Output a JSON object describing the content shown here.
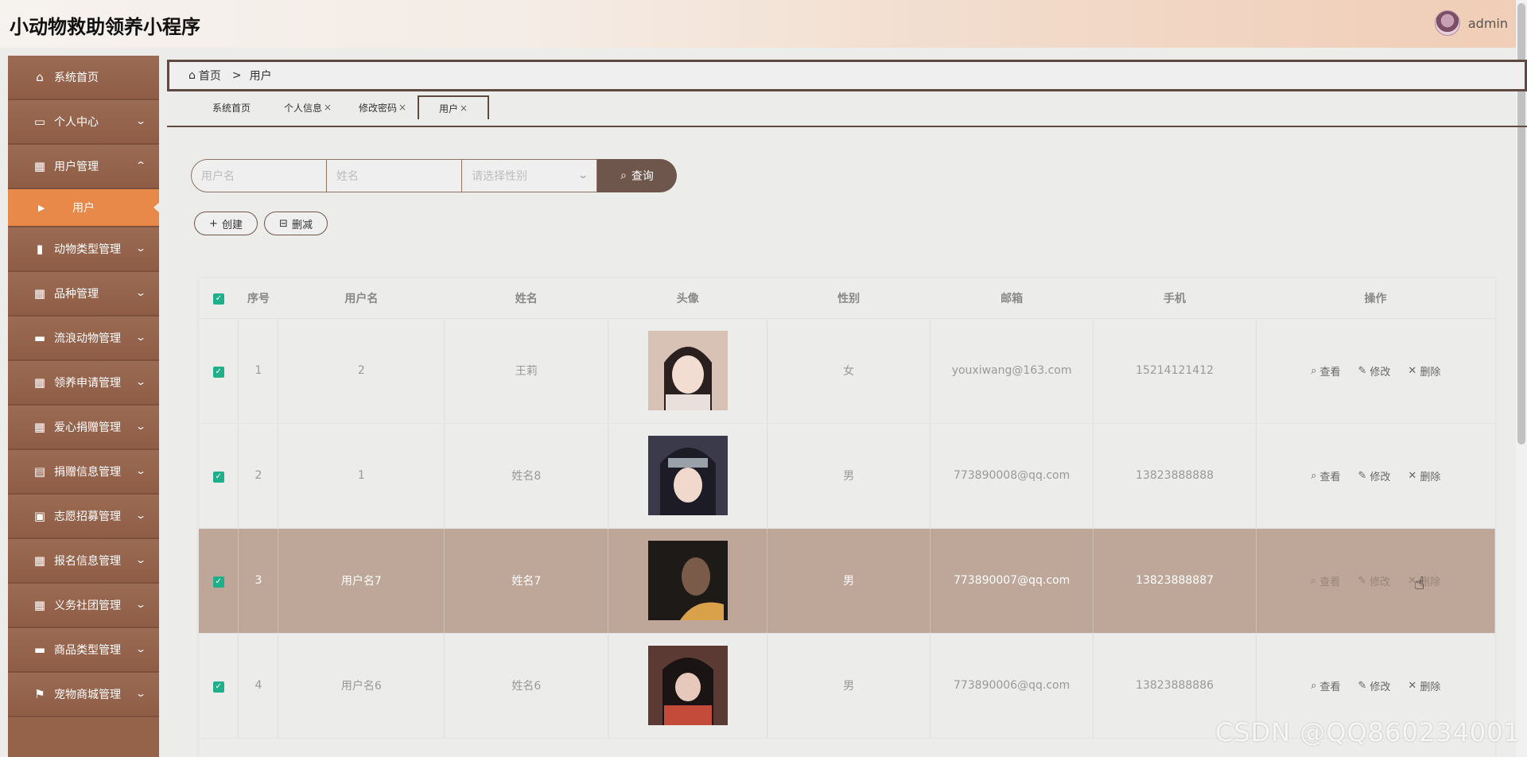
{
  "header": {
    "app_title": "小动物救助领养小程序",
    "user_name": "admin"
  },
  "sidebar": {
    "items": [
      {
        "label": "系统首页",
        "icon": "home-icon"
      },
      {
        "label": "个人中心",
        "icon": "wallet-icon"
      },
      {
        "label": "用户管理",
        "icon": "grid-icon"
      },
      {
        "label": "动物类型管理",
        "icon": "bar-chart-icon"
      },
      {
        "label": "品种管理",
        "icon": "grid-icon"
      },
      {
        "label": "流浪动物管理",
        "icon": "monitor-icon"
      },
      {
        "label": "领养申请管理",
        "icon": "grid-icon"
      },
      {
        "label": "爱心捐赠管理",
        "icon": "grid-icon"
      },
      {
        "label": "捐赠信息管理",
        "icon": "table-icon"
      },
      {
        "label": "志愿招募管理",
        "icon": "printer-icon"
      },
      {
        "label": "报名信息管理",
        "icon": "grid-icon"
      },
      {
        "label": "义务社团管理",
        "icon": "grid-icon"
      },
      {
        "label": "商品类型管理",
        "icon": "monitor-icon"
      },
      {
        "label": "宠物商城管理",
        "icon": "flag-icon"
      }
    ],
    "active_sub": "用户"
  },
  "breadcrumb": {
    "home": "首页",
    "separator": ">",
    "current": "用户"
  },
  "tabs": [
    {
      "label": "系统首页",
      "closable": false
    },
    {
      "label": "个人信息",
      "closable": true
    },
    {
      "label": "修改密码",
      "closable": true
    },
    {
      "label": "用户",
      "closable": true,
      "active": true
    }
  ],
  "tab_close": "×",
  "search": {
    "username_placeholder": "用户名",
    "name_placeholder": "姓名",
    "gender_placeholder": "请选择性别",
    "button_label": "查询"
  },
  "actions": {
    "create_label": "创建",
    "delete_label": "删减"
  },
  "table": {
    "headers": [
      "序号",
      "用户名",
      "姓名",
      "头像",
      "性别",
      "邮箱",
      "手机",
      "操作"
    ],
    "op_view": "查看",
    "op_edit": "修改",
    "op_delete": "删除",
    "rows": [
      {
        "index": "1",
        "username": "2",
        "name": "王莉",
        "gender": "女",
        "email": "youxiwang@163.com",
        "phone": "15214121412",
        "avatar_color": "#c9a79a"
      },
      {
        "index": "2",
        "username": "1",
        "name": "姓名8",
        "gender": "男",
        "email": "773890008@qq.com",
        "phone": "13823888888",
        "avatar_color": "#3b3a4a"
      },
      {
        "index": "3",
        "username": "用户名7",
        "name": "姓名7",
        "gender": "男",
        "email": "773890007@qq.com",
        "phone": "13823888887",
        "avatar_color": "#1e1a18",
        "highlighted": true
      },
      {
        "index": "4",
        "username": "用户名6",
        "name": "姓名6",
        "gender": "男",
        "email": "773890006@qq.com",
        "phone": "13823888886",
        "avatar_color": "#5a3a32"
      }
    ]
  },
  "watermark": "CSDN @QQ860234001",
  "colors": {
    "sidebar": "#95624a",
    "active_sub": "#e8894a",
    "accent_dark": "#6e564c",
    "row_highlight": "#bea698",
    "checkbox": "#1fb08a"
  }
}
